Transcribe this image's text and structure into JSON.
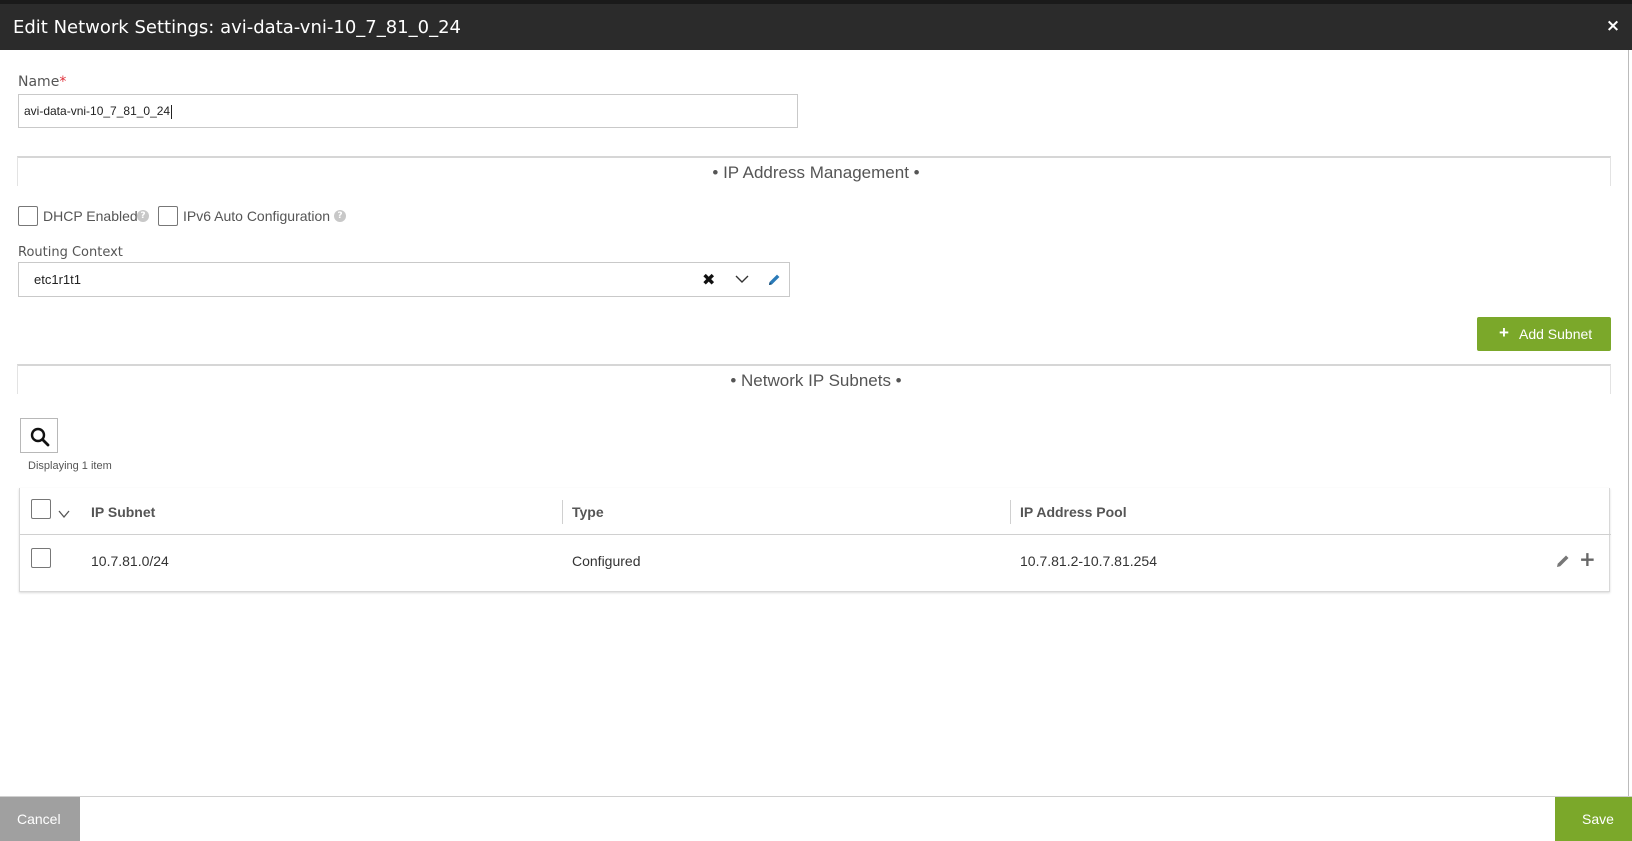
{
  "modal": {
    "title": "Edit Network Settings: avi-data-vni-10_7_81_0_24",
    "close_icon": "×"
  },
  "form": {
    "name_label": "Name",
    "required_mark": "*",
    "name_value": "avi-data-vni-10_7_81_0_24",
    "ipam_section_title": "• IP Address Management •",
    "dhcp_label": "DHCP Enabled",
    "dhcp_checked": false,
    "ipv6_label": "IPv6 Auto Configuration",
    "ipv6_checked": false,
    "help_glyph": "?",
    "routing_context_label": "Routing Context",
    "routing_context_value": "etc1r1t1",
    "clear_glyph": "✖",
    "add_subnet_label": "Add Subnet",
    "add_subnet_icon": "+",
    "subnets_section_title": "• Network IP Subnets •"
  },
  "grid": {
    "displaying_text": "Displaying 1 item",
    "columns": [
      "IP Subnet",
      "Type",
      "IP Address Pool"
    ],
    "rows": [
      {
        "subnet": "10.7.81.0/24",
        "type": "Configured",
        "pool": "10.7.81.2-10.7.81.254"
      }
    ],
    "row_add_icon": "+"
  },
  "footer": {
    "cancel_label": "Cancel",
    "save_label": "Save"
  },
  "colors": {
    "header_bg": "#2b2b2b",
    "accent_green": "#7ba82a",
    "required_red": "#e0303a",
    "cancel_gray": "#a0a0a0",
    "edit_blue": "#2a7ab8"
  }
}
